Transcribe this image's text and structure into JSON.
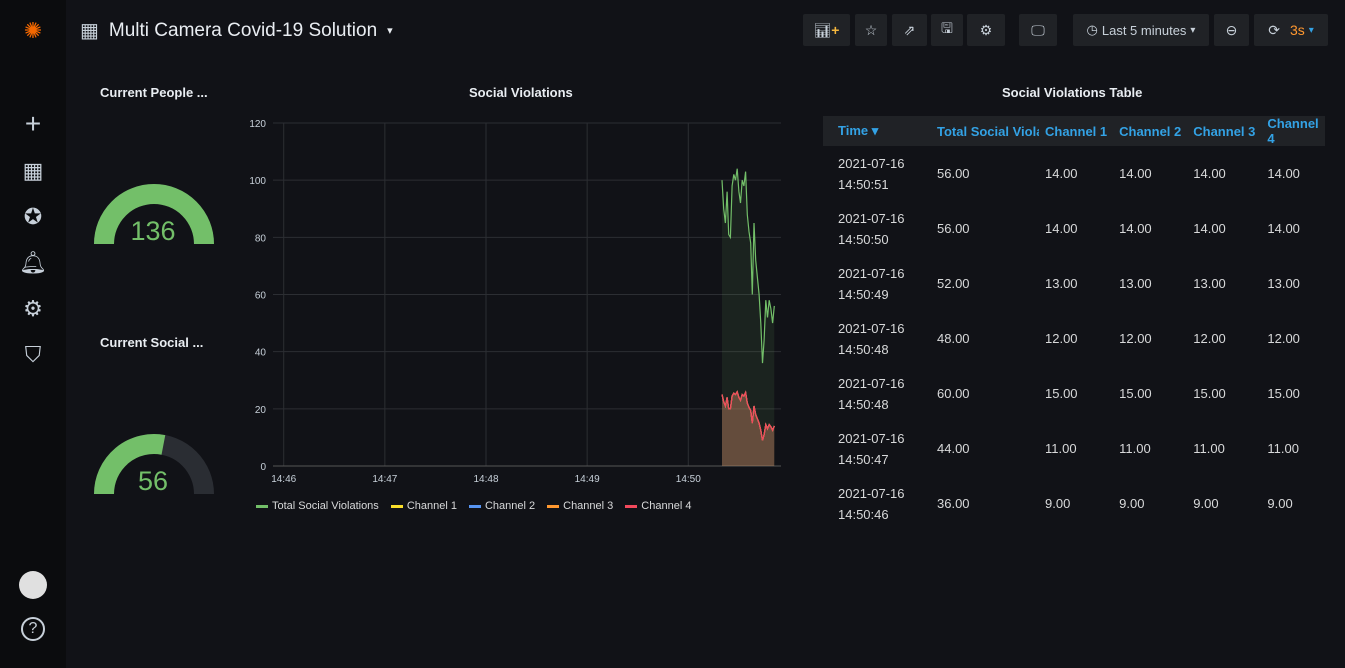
{
  "header": {
    "title": "Multi Camera Covid-19 Solution",
    "time_range": "Last 5 minutes",
    "refresh": "3s"
  },
  "sidebar": {
    "icons": [
      "grafana-logo",
      "plus-icon",
      "dashboards-icon",
      "explore-icon",
      "alert-bell-icon",
      "gear-icon",
      "shield-icon",
      "user-avatar",
      "help-icon"
    ]
  },
  "gauges": [
    {
      "title": "Current People ...",
      "value": 136,
      "fill": 1.0,
      "color": "#73bf69"
    },
    {
      "title": "Current Social ...",
      "value": 56,
      "fill": 0.56,
      "color": "#73bf69"
    }
  ],
  "chart_data": {
    "type": "line",
    "title": "Social Violations",
    "x": [
      "14:50:20",
      "14:50:21",
      "14:50:22",
      "14:50:23",
      "14:50:24",
      "14:50:25",
      "14:50:26",
      "14:50:27",
      "14:50:28",
      "14:50:29",
      "14:50:30",
      "14:50:31",
      "14:50:32",
      "14:50:33",
      "14:50:34",
      "14:50:35",
      "14:50:36",
      "14:50:37",
      "14:50:38",
      "14:50:39",
      "14:50:40",
      "14:50:41",
      "14:50:42",
      "14:50:43",
      "14:50:44",
      "14:50:45",
      "14:50:46",
      "14:50:47",
      "14:50:48",
      "14:50:49",
      "14:50:50",
      "14:50:51"
    ],
    "xticks": [
      "14:46",
      "14:47",
      "14:48",
      "14:49",
      "14:50"
    ],
    "xlim": [
      "14:45:40",
      "14:50:55"
    ],
    "yticks": [
      0,
      20,
      40,
      60,
      80,
      100,
      120
    ],
    "ylim": [
      0,
      120
    ],
    "grid": true,
    "legend": "bottom",
    "series": [
      {
        "name": "Total Social Violations",
        "color": "#73bf69",
        "values": [
          100,
          90,
          85,
          96,
          81,
          80,
          98,
          102,
          100,
          104,
          96,
          92,
          100,
          98,
          103,
          88,
          82,
          78,
          60,
          85,
          72,
          66,
          60,
          50,
          36,
          44,
          58,
          52,
          58,
          55,
          50,
          56
        ]
      },
      {
        "name": "Channel 1",
        "color": "#fade2a",
        "values": [
          25,
          22.5,
          21,
          24,
          20,
          20,
          24.5,
          25.5,
          25,
          26,
          24,
          23,
          25,
          24.5,
          25.75,
          22,
          20.5,
          19.5,
          15,
          21,
          18,
          16.5,
          15,
          12.5,
          9,
          11,
          14.5,
          13,
          14.5,
          13.75,
          12.5,
          14
        ]
      },
      {
        "name": "Channel 2",
        "color": "#5794f2",
        "values": [
          25,
          22.5,
          21,
          24,
          20,
          20,
          24.5,
          25.5,
          25,
          26,
          24,
          23,
          25,
          24.5,
          25.75,
          22,
          20.5,
          19.5,
          15,
          21,
          18,
          16.5,
          15,
          12.5,
          9,
          11,
          14.5,
          13,
          14.5,
          13.75,
          12.5,
          14
        ]
      },
      {
        "name": "Channel 3",
        "color": "#ff9830",
        "values": [
          25,
          22.5,
          21,
          24,
          20,
          20,
          24.5,
          25.5,
          25,
          26,
          24,
          23,
          25,
          24.5,
          25.75,
          22,
          20.5,
          19.5,
          15,
          21,
          18,
          16.5,
          15,
          12.5,
          9,
          11,
          14.5,
          13,
          14.5,
          13.75,
          12.5,
          14
        ]
      },
      {
        "name": "Channel 4",
        "color": "#f2495c",
        "values": [
          25,
          22.5,
          21,
          24,
          20,
          20,
          24.5,
          25.5,
          25,
          26,
          24,
          23,
          25,
          24.5,
          25.75,
          22,
          20.5,
          19.5,
          15,
          21,
          18,
          16.5,
          15,
          12.5,
          9,
          11,
          14.5,
          13,
          14.5,
          13.75,
          12.5,
          14
        ]
      }
    ]
  },
  "table": {
    "title": "Social Violations Table",
    "columns": [
      "Time ▾",
      "Total Social Violations",
      "Channel 1",
      "Channel 2",
      "Channel 3",
      "Channel 4"
    ],
    "rows": [
      [
        "2021-07-16",
        "14:50:51",
        "56.00",
        "14.00",
        "14.00",
        "14.00",
        "14.00"
      ],
      [
        "2021-07-16",
        "14:50:50",
        "56.00",
        "14.00",
        "14.00",
        "14.00",
        "14.00"
      ],
      [
        "2021-07-16",
        "14:50:49",
        "52.00",
        "13.00",
        "13.00",
        "13.00",
        "13.00"
      ],
      [
        "2021-07-16",
        "14:50:48",
        "48.00",
        "12.00",
        "12.00",
        "12.00",
        "12.00"
      ],
      [
        "2021-07-16",
        "14:50:48",
        "60.00",
        "15.00",
        "15.00",
        "15.00",
        "15.00"
      ],
      [
        "2021-07-16",
        "14:50:47",
        "44.00",
        "11.00",
        "11.00",
        "11.00",
        "11.00"
      ],
      [
        "2021-07-16",
        "14:50:46",
        "36.00",
        "9.00",
        "9.00",
        "9.00",
        "9.00"
      ]
    ]
  }
}
